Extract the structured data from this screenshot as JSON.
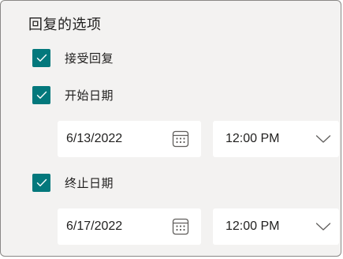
{
  "section_title": "回复的选项",
  "options": {
    "accept_responses": {
      "label": "接受回复",
      "checked": true
    },
    "start_date": {
      "label": "开始日期",
      "checked": true,
      "date": "6/13/2022",
      "time": "12:00 PM"
    },
    "end_date": {
      "label": "终止日期",
      "checked": true,
      "date": "6/17/2022",
      "time": "12:00 PM"
    }
  },
  "colors": {
    "checkbox": "#03787c",
    "panel_background": "#f3f2f1",
    "field_background": "#ffffff"
  },
  "icons": {
    "checkbox_mark": "checkmark-icon",
    "date_picker": "calendar-icon",
    "time_dropdown": "chevron-down-icon"
  }
}
